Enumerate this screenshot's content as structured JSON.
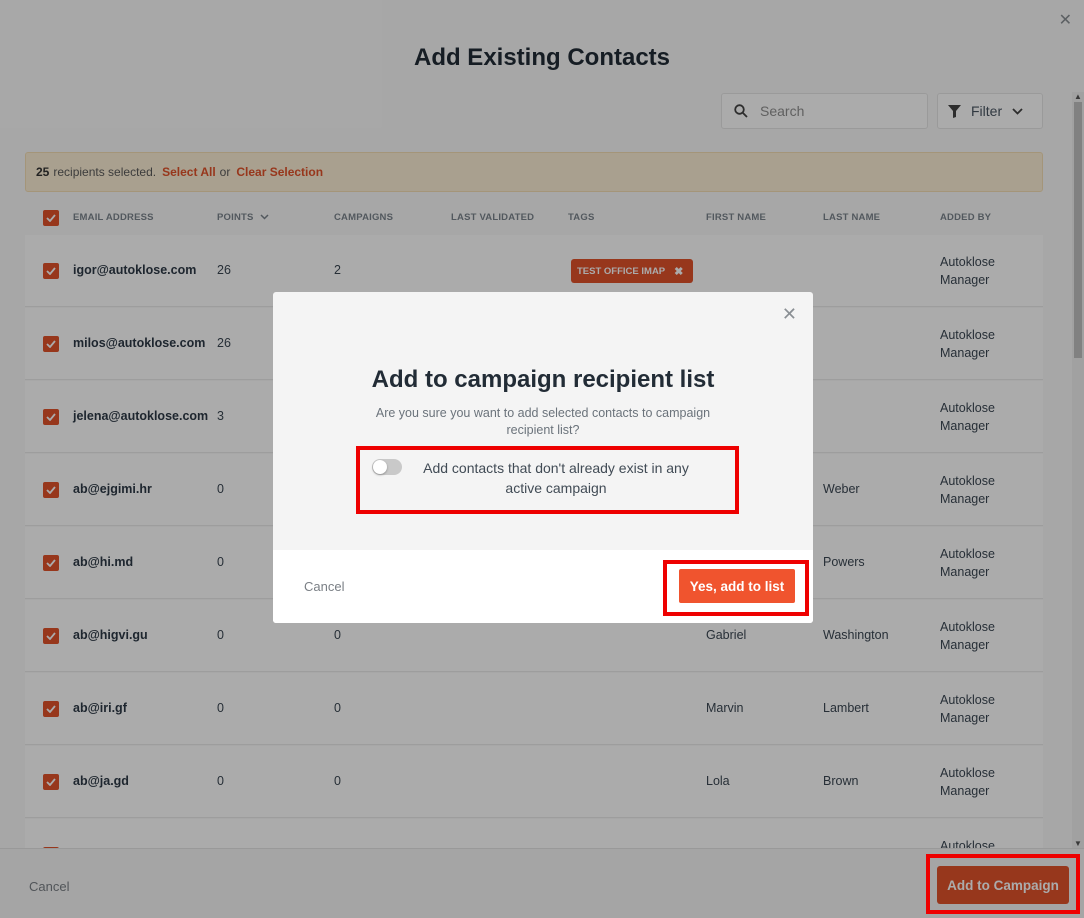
{
  "page": {
    "title": "Add Existing Contacts",
    "close_icon": "close-icon",
    "search_placeholder": "Search",
    "filter_label": "Filter"
  },
  "selection": {
    "count": "25",
    "text": "recipients selected.",
    "select_all": "Select All",
    "or": "or",
    "clear": "Clear Selection"
  },
  "table": {
    "columns": [
      "EMAIL ADDRESS",
      "POINTS",
      "CAMPAIGNS",
      "LAST VALIDATED",
      "TAGS",
      "FIRST NAME",
      "LAST NAME",
      "ADDED BY"
    ],
    "rows": [
      {
        "email": "igor@autoklose.com",
        "points": "26",
        "campaigns": "2",
        "tag": "TEST OFFICE IMAP",
        "first": "",
        "last": "",
        "added": "Autoklose Manager"
      },
      {
        "email": "milos@autoklose.com",
        "points": "26",
        "campaigns": "",
        "tag": "",
        "first": "",
        "last": "",
        "added": "Autoklose Manager"
      },
      {
        "email": "jelena@autoklose.com",
        "points": "3",
        "campaigns": "",
        "tag": "",
        "first": "",
        "last": "",
        "added": "Autoklose Manager"
      },
      {
        "email": "ab@ejgimi.hr",
        "points": "0",
        "campaigns": "",
        "tag": "",
        "first": "",
        "last": "Weber",
        "added": "Autoklose Manager"
      },
      {
        "email": "ab@hi.md",
        "points": "0",
        "campaigns": "",
        "tag": "",
        "first": "",
        "last": "Powers",
        "added": "Autoklose Manager"
      },
      {
        "email": "ab@higvi.gu",
        "points": "0",
        "campaigns": "0",
        "tag": "",
        "first": "Gabriel",
        "last": "Washington",
        "added": "Autoklose Manager"
      },
      {
        "email": "ab@iri.gf",
        "points": "0",
        "campaigns": "0",
        "tag": "",
        "first": "Marvin",
        "last": "Lambert",
        "added": "Autoklose Manager"
      },
      {
        "email": "ab@ja.gd",
        "points": "0",
        "campaigns": "0",
        "tag": "",
        "first": "Lola",
        "last": "Brown",
        "added": "Autoklose Manager"
      },
      {
        "email": "",
        "points": "",
        "campaigns": "",
        "tag": "",
        "first": "",
        "last": "",
        "added": "Autoklose"
      }
    ]
  },
  "footer": {
    "cancel": "Cancel",
    "add_to_campaign": "Add to Campaign"
  },
  "modal": {
    "title": "Add to campaign recipient list",
    "text": "Are you sure you want to add selected contacts to campaign recipient list?",
    "toggle_label": "Add contacts that don't already exist in any active campaign",
    "toggle_on": false,
    "cancel": "Cancel",
    "confirm": "Yes, add to list"
  },
  "colors": {
    "accent": "#e2522b",
    "highlight": "#ee0000"
  }
}
